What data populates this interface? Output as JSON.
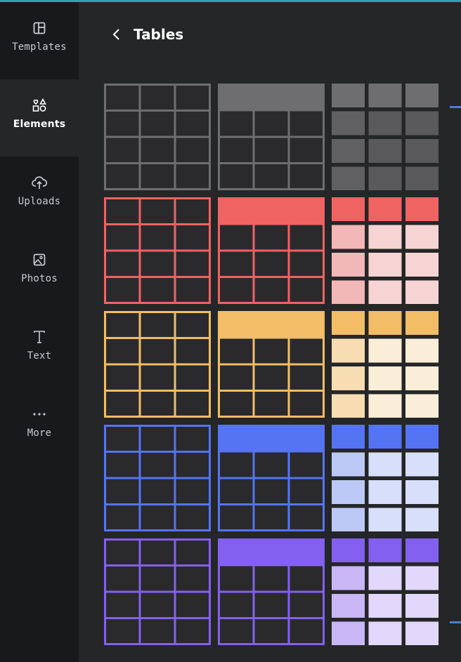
{
  "rail": {
    "items": [
      {
        "label": "Templates",
        "icon": "layout-icon"
      },
      {
        "label": "Elements",
        "icon": "shapes-icon"
      },
      {
        "label": "Uploads",
        "icon": "cloud-upload-icon"
      },
      {
        "label": "Photos",
        "icon": "image-icon"
      },
      {
        "label": "Text",
        "icon": "text-icon"
      },
      {
        "label": "More",
        "icon": "more-dots-icon"
      }
    ],
    "active": "Elements"
  },
  "panel": {
    "back_icon": "chevron-left-icon",
    "title": "Tables"
  },
  "tables": {
    "rows": [
      {
        "theme": "gray",
        "main": "#6e6e70",
        "light": "#606062",
        "lighter": "#5a5a5c"
      },
      {
        "theme": "red",
        "main": "#ef6363",
        "light": "#f2b7b7",
        "lighter": "#f7d4d4"
      },
      {
        "theme": "yellow",
        "main": "#f2bd66",
        "light": "#f8dcb2",
        "lighter": "#fbeed8"
      },
      {
        "theme": "blue",
        "main": "#5474f3",
        "light": "#bcc8f6",
        "lighter": "#d8dffb"
      },
      {
        "theme": "purple",
        "main": "#8360f0",
        "light": "#c8b6f5",
        "lighter": "#e2d8fb"
      }
    ],
    "styles": [
      "outline-grid",
      "header-grid",
      "striped-cells"
    ]
  }
}
